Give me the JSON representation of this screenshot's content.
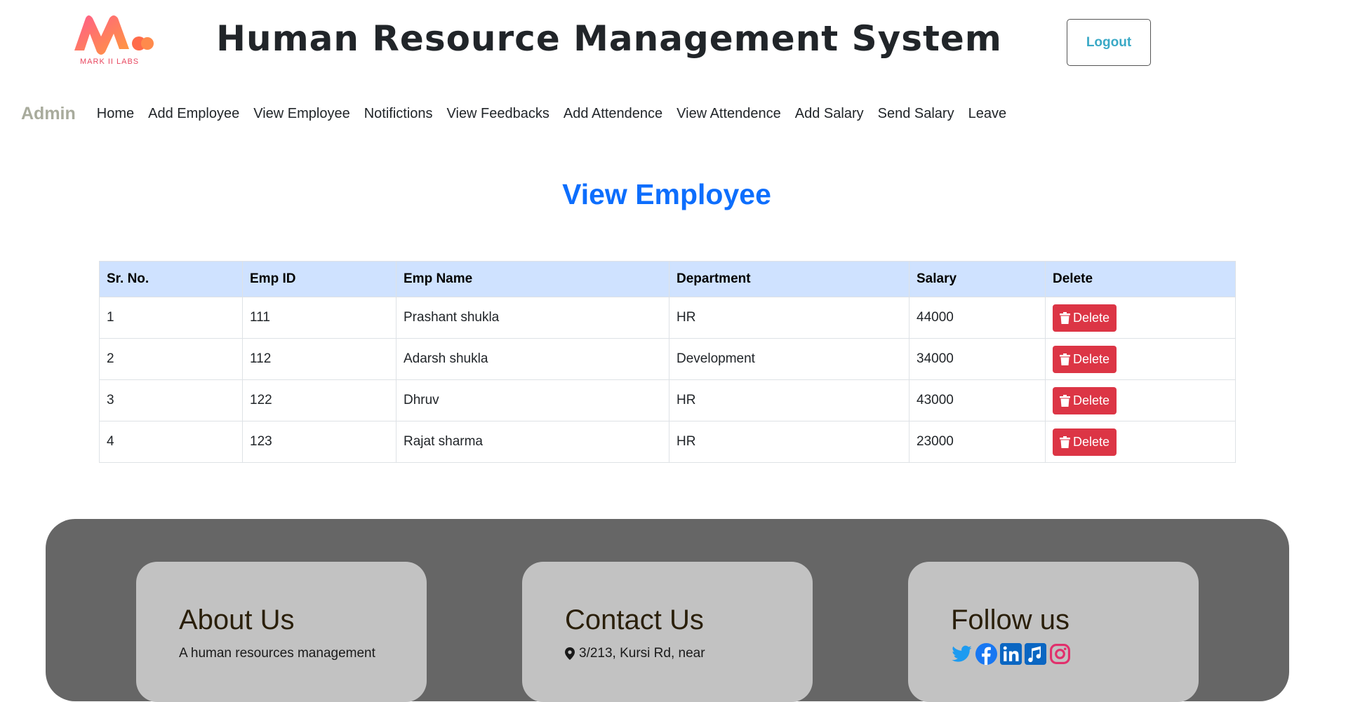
{
  "header": {
    "logo_text": "MARK II LABS",
    "title": "Human Resource Management System",
    "logout_label": "Logout"
  },
  "nav": {
    "brand": "Admin",
    "items": [
      {
        "label": "Home"
      },
      {
        "label": "Add Employee"
      },
      {
        "label": "View Employee"
      },
      {
        "label": "Notifictions"
      },
      {
        "label": "View Feedbacks"
      },
      {
        "label": "Add Attendence"
      },
      {
        "label": "View Attendence"
      },
      {
        "label": "Add Salary"
      },
      {
        "label": "Send Salary"
      },
      {
        "label": "Leave"
      }
    ]
  },
  "main": {
    "title": "View Employee",
    "table": {
      "headers": [
        "Sr. No.",
        "Emp ID",
        "Emp Name",
        "Department",
        "Salary",
        "Delete"
      ],
      "delete_label": "Delete",
      "rows": [
        {
          "sr": "1",
          "id": "111",
          "name": "Prashant shukla",
          "dept": "HR",
          "salary": "44000"
        },
        {
          "sr": "2",
          "id": "112",
          "name": "Adarsh shukla",
          "dept": "Development",
          "salary": "34000"
        },
        {
          "sr": "3",
          "id": "122",
          "name": "Dhruv",
          "dept": "HR",
          "salary": "43000"
        },
        {
          "sr": "4",
          "id": "123",
          "name": "Rajat sharma",
          "dept": "HR",
          "salary": "23000"
        }
      ]
    }
  },
  "footer": {
    "about_title": "About Us",
    "about_text": "A human resources management",
    "contact_title": "Contact Us",
    "contact_text": "3/213, Kursi Rd, near",
    "follow_title": "Follow us",
    "socials": [
      "twitter-icon",
      "facebook-icon",
      "linkedin-icon",
      "music-icon",
      "instagram-icon"
    ]
  },
  "colors": {
    "accent": "#0d6efd",
    "danger": "#dc3545",
    "table_head": "#cfe2ff",
    "footer_bg": "#666666",
    "card_bg": "#c2c2c2"
  }
}
